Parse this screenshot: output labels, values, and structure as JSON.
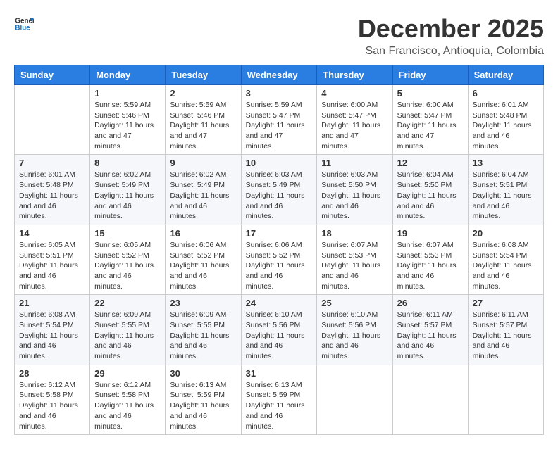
{
  "header": {
    "logo_line1": "General",
    "logo_line2": "Blue",
    "title": "December 2025",
    "subtitle": "San Francisco, Antioquia, Colombia"
  },
  "calendar": {
    "days_of_week": [
      "Sunday",
      "Monday",
      "Tuesday",
      "Wednesday",
      "Thursday",
      "Friday",
      "Saturday"
    ],
    "weeks": [
      [
        {
          "day": "",
          "sunrise": "",
          "sunset": "",
          "daylight": ""
        },
        {
          "day": "1",
          "sunrise": "Sunrise: 5:59 AM",
          "sunset": "Sunset: 5:46 PM",
          "daylight": "Daylight: 11 hours and 47 minutes."
        },
        {
          "day": "2",
          "sunrise": "Sunrise: 5:59 AM",
          "sunset": "Sunset: 5:46 PM",
          "daylight": "Daylight: 11 hours and 47 minutes."
        },
        {
          "day": "3",
          "sunrise": "Sunrise: 5:59 AM",
          "sunset": "Sunset: 5:47 PM",
          "daylight": "Daylight: 11 hours and 47 minutes."
        },
        {
          "day": "4",
          "sunrise": "Sunrise: 6:00 AM",
          "sunset": "Sunset: 5:47 PM",
          "daylight": "Daylight: 11 hours and 47 minutes."
        },
        {
          "day": "5",
          "sunrise": "Sunrise: 6:00 AM",
          "sunset": "Sunset: 5:47 PM",
          "daylight": "Daylight: 11 hours and 47 minutes."
        },
        {
          "day": "6",
          "sunrise": "Sunrise: 6:01 AM",
          "sunset": "Sunset: 5:48 PM",
          "daylight": "Daylight: 11 hours and 46 minutes."
        }
      ],
      [
        {
          "day": "7",
          "sunrise": "Sunrise: 6:01 AM",
          "sunset": "Sunset: 5:48 PM",
          "daylight": "Daylight: 11 hours and 46 minutes."
        },
        {
          "day": "8",
          "sunrise": "Sunrise: 6:02 AM",
          "sunset": "Sunset: 5:49 PM",
          "daylight": "Daylight: 11 hours and 46 minutes."
        },
        {
          "day": "9",
          "sunrise": "Sunrise: 6:02 AM",
          "sunset": "Sunset: 5:49 PM",
          "daylight": "Daylight: 11 hours and 46 minutes."
        },
        {
          "day": "10",
          "sunrise": "Sunrise: 6:03 AM",
          "sunset": "Sunset: 5:49 PM",
          "daylight": "Daylight: 11 hours and 46 minutes."
        },
        {
          "day": "11",
          "sunrise": "Sunrise: 6:03 AM",
          "sunset": "Sunset: 5:50 PM",
          "daylight": "Daylight: 11 hours and 46 minutes."
        },
        {
          "day": "12",
          "sunrise": "Sunrise: 6:04 AM",
          "sunset": "Sunset: 5:50 PM",
          "daylight": "Daylight: 11 hours and 46 minutes."
        },
        {
          "day": "13",
          "sunrise": "Sunrise: 6:04 AM",
          "sunset": "Sunset: 5:51 PM",
          "daylight": "Daylight: 11 hours and 46 minutes."
        }
      ],
      [
        {
          "day": "14",
          "sunrise": "Sunrise: 6:05 AM",
          "sunset": "Sunset: 5:51 PM",
          "daylight": "Daylight: 11 hours and 46 minutes."
        },
        {
          "day": "15",
          "sunrise": "Sunrise: 6:05 AM",
          "sunset": "Sunset: 5:52 PM",
          "daylight": "Daylight: 11 hours and 46 minutes."
        },
        {
          "day": "16",
          "sunrise": "Sunrise: 6:06 AM",
          "sunset": "Sunset: 5:52 PM",
          "daylight": "Daylight: 11 hours and 46 minutes."
        },
        {
          "day": "17",
          "sunrise": "Sunrise: 6:06 AM",
          "sunset": "Sunset: 5:52 PM",
          "daylight": "Daylight: 11 hours and 46 minutes."
        },
        {
          "day": "18",
          "sunrise": "Sunrise: 6:07 AM",
          "sunset": "Sunset: 5:53 PM",
          "daylight": "Daylight: 11 hours and 46 minutes."
        },
        {
          "day": "19",
          "sunrise": "Sunrise: 6:07 AM",
          "sunset": "Sunset: 5:53 PM",
          "daylight": "Daylight: 11 hours and 46 minutes."
        },
        {
          "day": "20",
          "sunrise": "Sunrise: 6:08 AM",
          "sunset": "Sunset: 5:54 PM",
          "daylight": "Daylight: 11 hours and 46 minutes."
        }
      ],
      [
        {
          "day": "21",
          "sunrise": "Sunrise: 6:08 AM",
          "sunset": "Sunset: 5:54 PM",
          "daylight": "Daylight: 11 hours and 46 minutes."
        },
        {
          "day": "22",
          "sunrise": "Sunrise: 6:09 AM",
          "sunset": "Sunset: 5:55 PM",
          "daylight": "Daylight: 11 hours and 46 minutes."
        },
        {
          "day": "23",
          "sunrise": "Sunrise: 6:09 AM",
          "sunset": "Sunset: 5:55 PM",
          "daylight": "Daylight: 11 hours and 46 minutes."
        },
        {
          "day": "24",
          "sunrise": "Sunrise: 6:10 AM",
          "sunset": "Sunset: 5:56 PM",
          "daylight": "Daylight: 11 hours and 46 minutes."
        },
        {
          "day": "25",
          "sunrise": "Sunrise: 6:10 AM",
          "sunset": "Sunset: 5:56 PM",
          "daylight": "Daylight: 11 hours and 46 minutes."
        },
        {
          "day": "26",
          "sunrise": "Sunrise: 6:11 AM",
          "sunset": "Sunset: 5:57 PM",
          "daylight": "Daylight: 11 hours and 46 minutes."
        },
        {
          "day": "27",
          "sunrise": "Sunrise: 6:11 AM",
          "sunset": "Sunset: 5:57 PM",
          "daylight": "Daylight: 11 hours and 46 minutes."
        }
      ],
      [
        {
          "day": "28",
          "sunrise": "Sunrise: 6:12 AM",
          "sunset": "Sunset: 5:58 PM",
          "daylight": "Daylight: 11 hours and 46 minutes."
        },
        {
          "day": "29",
          "sunrise": "Sunrise: 6:12 AM",
          "sunset": "Sunset: 5:58 PM",
          "daylight": "Daylight: 11 hours and 46 minutes."
        },
        {
          "day": "30",
          "sunrise": "Sunrise: 6:13 AM",
          "sunset": "Sunset: 5:59 PM",
          "daylight": "Daylight: 11 hours and 46 minutes."
        },
        {
          "day": "31",
          "sunrise": "Sunrise: 6:13 AM",
          "sunset": "Sunset: 5:59 PM",
          "daylight": "Daylight: 11 hours and 46 minutes."
        },
        {
          "day": "",
          "sunrise": "",
          "sunset": "",
          "daylight": ""
        },
        {
          "day": "",
          "sunrise": "",
          "sunset": "",
          "daylight": ""
        },
        {
          "day": "",
          "sunrise": "",
          "sunset": "",
          "daylight": ""
        }
      ]
    ]
  }
}
